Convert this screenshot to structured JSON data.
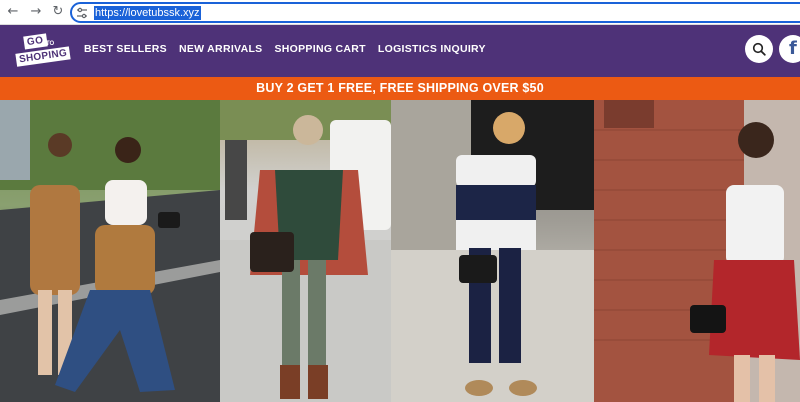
{
  "browser": {
    "url": "https://lovetubssk.xyz",
    "icons": [
      "back-arrow-icon",
      "forward-arrow-icon",
      "reload-icon",
      "site-settings-icon"
    ]
  },
  "header": {
    "logo": {
      "line1": "GO",
      "to": "TO",
      "line2": "SHOPING"
    },
    "nav": [
      {
        "label": "BEST SELLERS"
      },
      {
        "label": "NEW ARRIVALS"
      },
      {
        "label": "SHOPPING CART"
      },
      {
        "label": "LOGISTICS INQUIRY"
      }
    ],
    "icons": [
      "search-icon",
      "facebook-icon"
    ],
    "colors": {
      "header_bg": "#4e3278",
      "promo_bg": "#ec5a13"
    }
  },
  "promo": {
    "text": "BUY 2 GET 1 FREE, FREE SHIPPING OVER $50"
  },
  "hero": {
    "photos": [
      {
        "subject": "two women walking on a street"
      },
      {
        "subject": "woman in plaid scarf with handbag"
      },
      {
        "subject": "woman in navy and white striped top"
      },
      {
        "subject": "woman with plaid shirt tied at waist"
      }
    ]
  }
}
